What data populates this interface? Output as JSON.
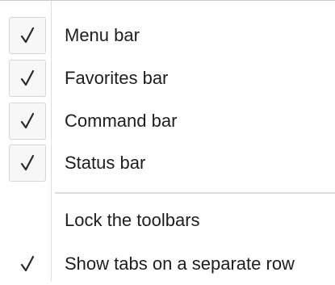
{
  "menu": {
    "items": [
      {
        "label": "Menu bar",
        "checked": true,
        "icon": "check-icon"
      },
      {
        "label": "Favorites bar",
        "checked": true,
        "icon": "check-icon"
      },
      {
        "label": "Command bar",
        "checked": true,
        "icon": "check-icon"
      },
      {
        "label": "Status bar",
        "checked": true,
        "icon": "check-icon"
      },
      {
        "label": "Lock the toolbars",
        "checked": false
      },
      {
        "label": "Show tabs on a separate row",
        "checked": true,
        "icon": "check-icon"
      }
    ]
  }
}
